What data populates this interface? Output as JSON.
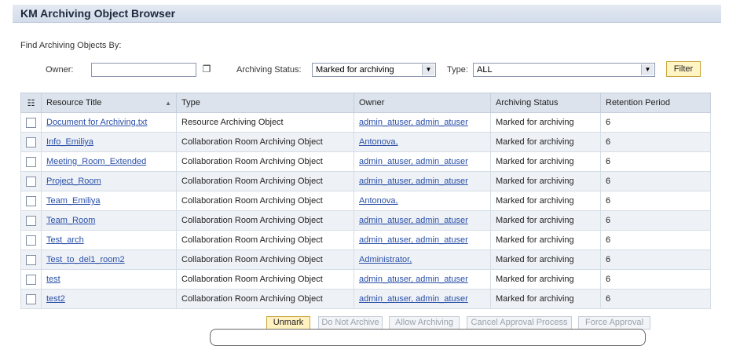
{
  "header": {
    "title": "KM Archiving Object Browser"
  },
  "find": {
    "label": "Find Archiving Objects By:"
  },
  "filters": {
    "owner_label": "Owner:",
    "owner_value": "",
    "status_label": "Archiving Status:",
    "status_value": "Marked for archiving",
    "type_label": "Type:",
    "type_value": "ALL",
    "filter_button": "Filter"
  },
  "table": {
    "columns": [
      "Resource Title",
      "Type",
      "Owner",
      "Archiving Status",
      "Retention Period"
    ],
    "rows": [
      {
        "title": "Document for Archiving.txt",
        "type": "Resource Archiving Object",
        "owner": "admin_atuser, admin_atuser",
        "status": "Marked for archiving",
        "retention": "6"
      },
      {
        "title": "Info_Emiliya",
        "type": "Collaboration Room Archiving Object",
        "owner": "Antonova,",
        "status": "Marked for archiving",
        "retention": "6"
      },
      {
        "title": "Meeting_Room_Extended",
        "type": "Collaboration Room Archiving Object",
        "owner": "admin_atuser, admin_atuser",
        "status": "Marked for archiving",
        "retention": "6"
      },
      {
        "title": "Project_Room",
        "type": "Collaboration Room Archiving Object",
        "owner": "admin_atuser, admin_atuser",
        "status": "Marked for archiving",
        "retention": "6"
      },
      {
        "title": "Team_Emiliya",
        "type": "Collaboration Room Archiving Object",
        "owner": "Antonova,",
        "status": "Marked for archiving",
        "retention": "6"
      },
      {
        "title": "Team_Room",
        "type": "Collaboration Room Archiving Object",
        "owner": "admin_atuser, admin_atuser",
        "status": "Marked for archiving",
        "retention": "6"
      },
      {
        "title": "Test_arch",
        "type": "Collaboration Room Archiving Object",
        "owner": "admin_atuser, admin_atuser",
        "status": "Marked for archiving",
        "retention": "6"
      },
      {
        "title": "Test_to_del1_room2",
        "type": "Collaboration Room Archiving Object",
        "owner": "Administrator,",
        "status": "Marked for archiving",
        "retention": "6"
      },
      {
        "title": "test",
        "type": "Collaboration Room Archiving Object",
        "owner": "admin_atuser, admin_atuser",
        "status": "Marked for archiving",
        "retention": "6"
      },
      {
        "title": "test2",
        "type": "Collaboration Room Archiving Object",
        "owner": "admin_atuser, admin_atuser",
        "status": "Marked for archiving",
        "retention": "6"
      }
    ]
  },
  "actions": {
    "unmark": "Unmark",
    "do_not_archive": "Do Not Archive",
    "allow_archiving": "Allow Archiving",
    "cancel_approval": "Cancel Approval Process",
    "force_approval": "Force Approval"
  },
  "icons": {
    "select_all": "select-all-icon",
    "value_help": "value-help-icon",
    "sort": "sort-ascending-icon",
    "dropdown": "chevron-down-icon"
  }
}
